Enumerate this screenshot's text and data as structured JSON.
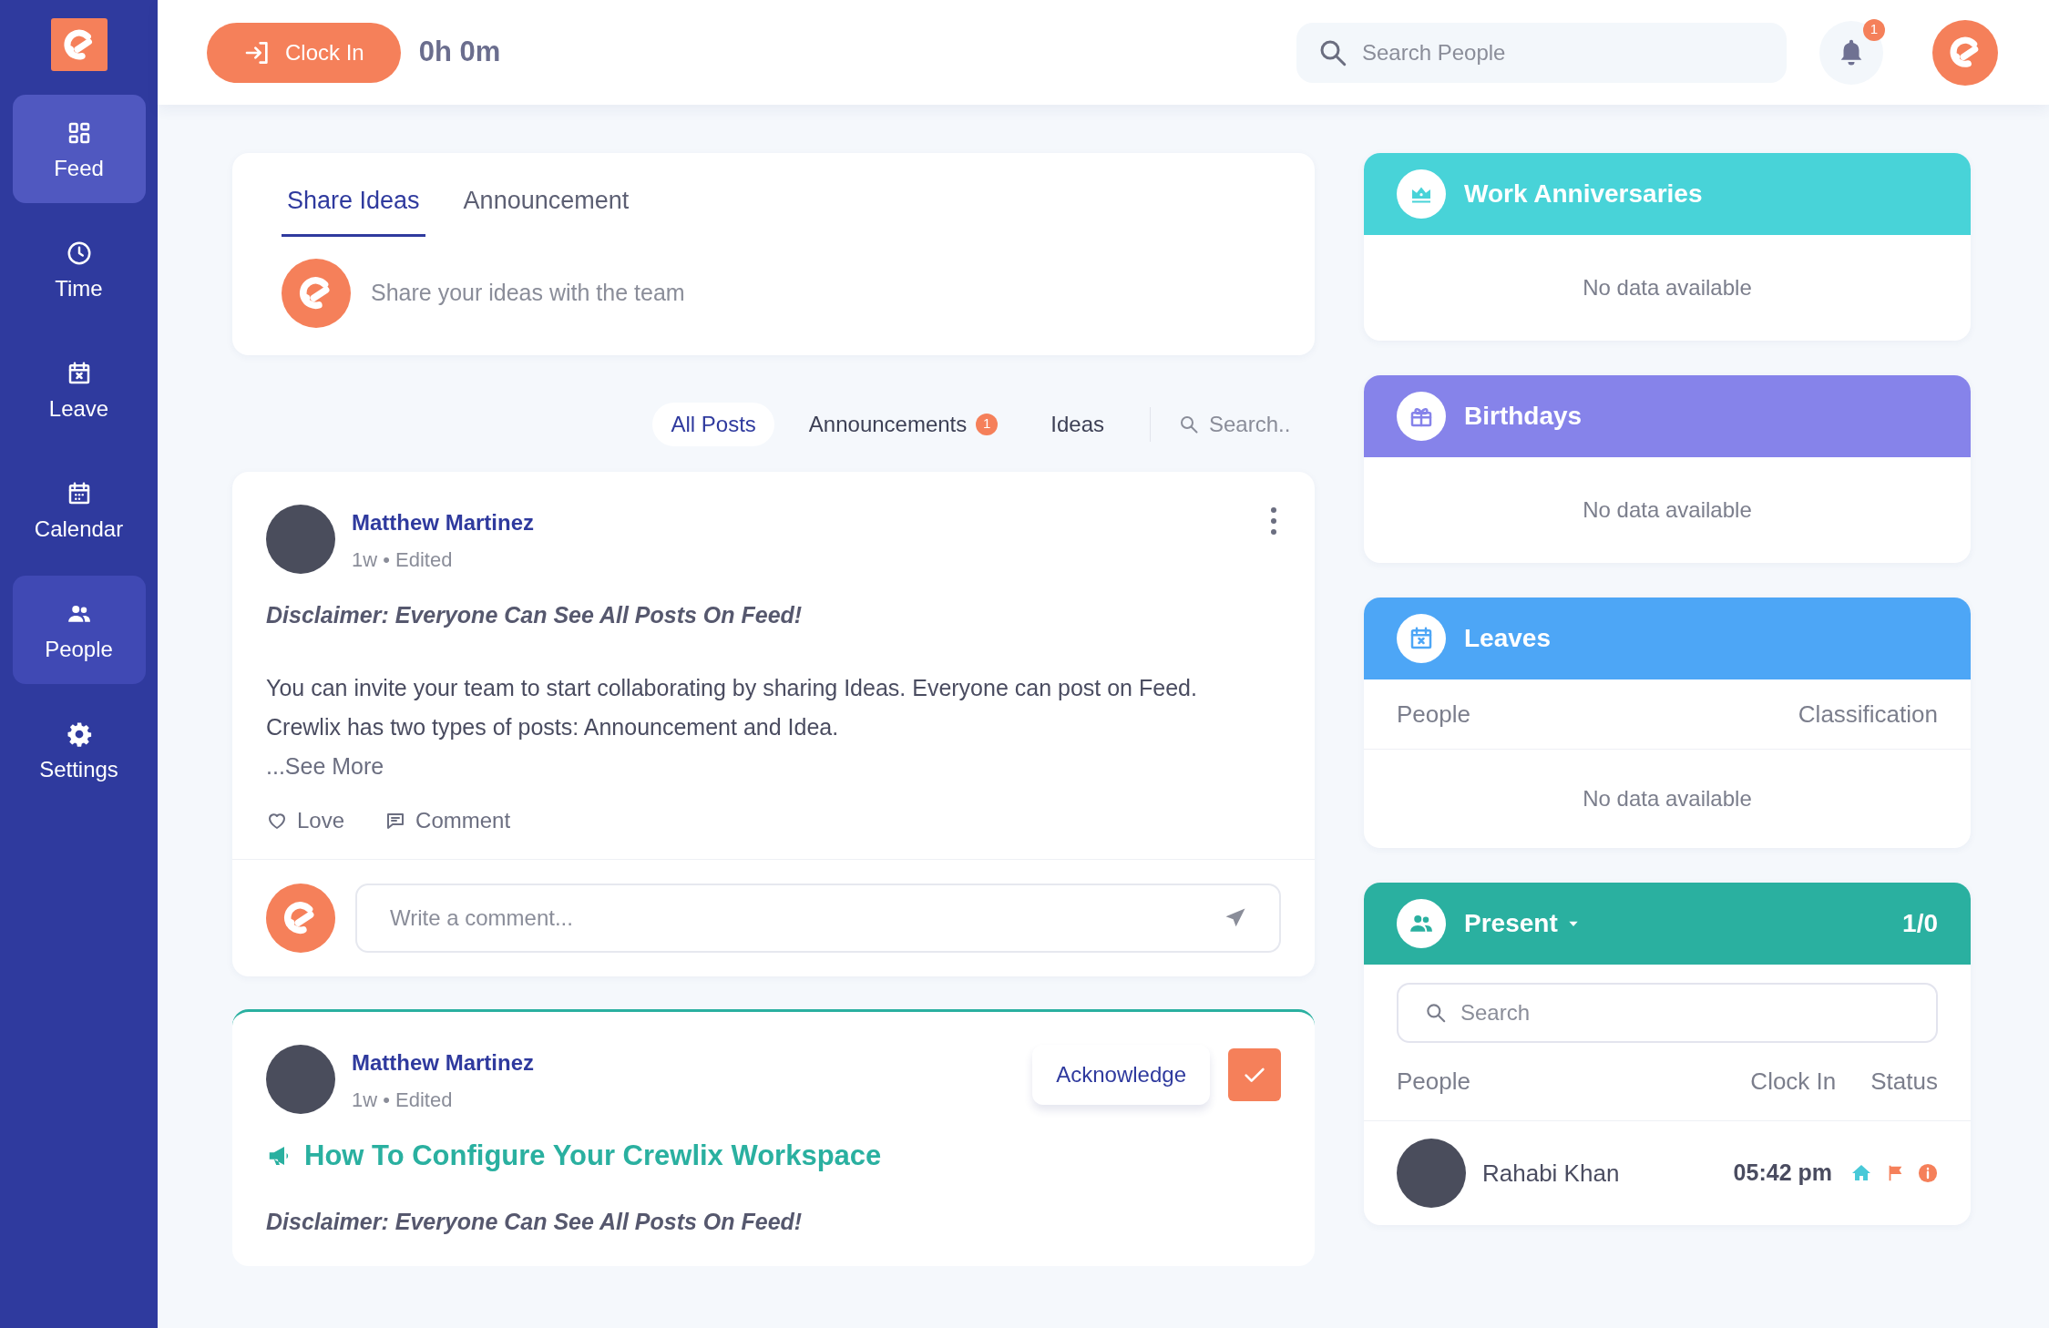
{
  "sidebar": {
    "items": [
      {
        "label": "Feed",
        "selected": true,
        "hovered": false
      },
      {
        "label": "Time",
        "selected": false,
        "hovered": false
      },
      {
        "label": "Leave",
        "selected": false,
        "hovered": false
      },
      {
        "label": "Calendar",
        "selected": false,
        "hovered": false
      },
      {
        "label": "People",
        "selected": false,
        "hovered": true
      },
      {
        "label": "Settings",
        "selected": false,
        "hovered": false
      }
    ]
  },
  "top_bar": {
    "clock_in_button": "Clock In",
    "timer": "0h 0m",
    "search": {
      "placeholder": "Search People"
    },
    "notification_count": "1"
  },
  "composer": {
    "tabs": [
      {
        "label": "Share Ideas",
        "selected": true
      },
      {
        "label": "Announcement",
        "selected": false
      }
    ],
    "placeholder": "Share your ideas with the team"
  },
  "filters": {
    "items": [
      {
        "label": "All Posts",
        "selected": true
      },
      {
        "label": "Announcements",
        "badge": "1",
        "selected": false
      },
      {
        "label": "Ideas",
        "selected": false
      }
    ],
    "search": {
      "placeholder": "Search.."
    }
  },
  "posts": [
    {
      "kind": "idea",
      "author": "Matthew Martinez",
      "meta": "1w • Edited",
      "disclaimer": "Disclaimer: Everyone Can See All Posts On Feed!",
      "body": [
        "You can invite your team to start collaborating by sharing Ideas. Everyone can post on Feed.",
        "Crewlix has two types of posts: Announcement and Idea."
      ],
      "see_more": "...See More",
      "actions": [
        "Love",
        "Comment"
      ],
      "comment": {
        "placeholder": "Write a comment..."
      }
    },
    {
      "kind": "announcement",
      "author": "Matthew Martinez",
      "meta": "1w • Edited",
      "acknowledge": "Acknowledge",
      "acknowledged": true,
      "title": "How To Configure Your Crewlix Workspace",
      "disclaimer": "Disclaimer: Everyone Can See All Posts On Feed!"
    }
  ],
  "widgets": [
    {
      "kind": "empty",
      "title": "Work Anniversaries",
      "color": "#48d3d8",
      "message": "No data available"
    },
    {
      "kind": "empty",
      "title": "Birthdays",
      "color": "#8683ea",
      "message": "No data available"
    },
    {
      "kind": "table",
      "title": "Leaves",
      "color": "#4da6f6",
      "columns": [
        "People",
        "Classification"
      ],
      "message": "No data available"
    },
    {
      "kind": "present",
      "title": "Present",
      "color": "#2ab0a0",
      "count": "1/0",
      "search": {
        "placeholder": "Search"
      },
      "columns": [
        "People",
        "Clock In",
        "Status"
      ],
      "rows": [
        {
          "name": "Rahabi Khan",
          "clock_in": "05:42 pm"
        }
      ]
    }
  ]
}
